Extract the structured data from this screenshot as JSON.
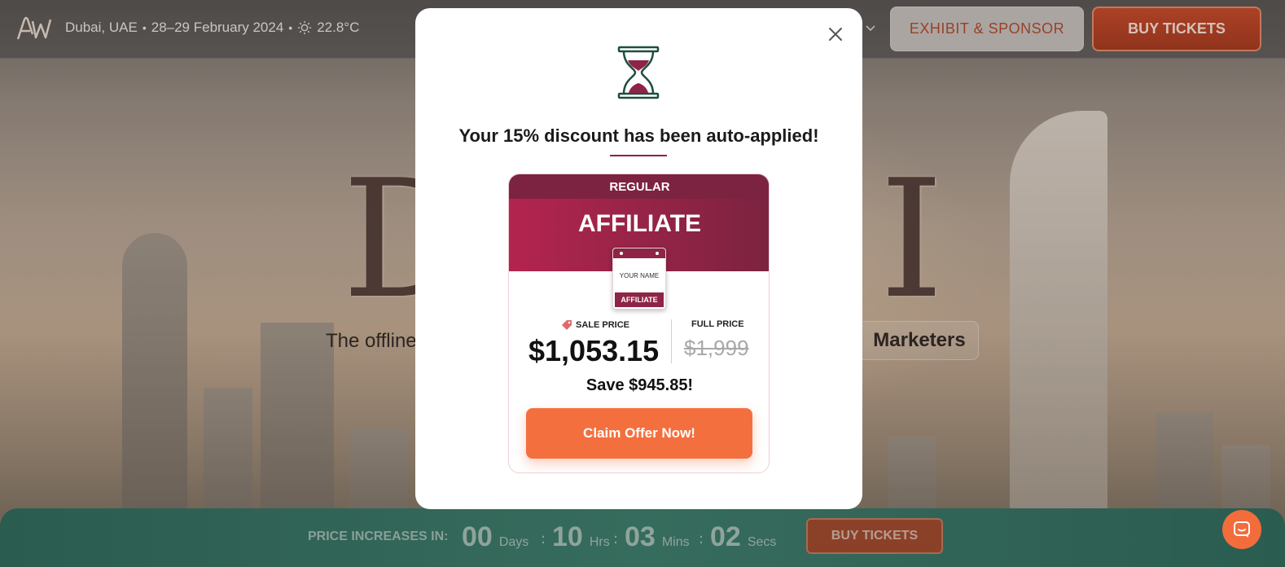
{
  "header": {
    "location": "Dubai, UAE",
    "dates": "28–29 February 2024",
    "separator": "•",
    "temperature": "22.8°C",
    "exhibit_button": "EXHIBIT & SPONSOR",
    "buy_button": "BUY TICKETS"
  },
  "hero": {
    "tagline": "The offline",
    "pill_text": "Marketers"
  },
  "modal": {
    "headline": "Your 15% discount has been auto-applied!",
    "ticket": {
      "tier": "REGULAR",
      "name": "AFFILIATE",
      "badge_name": "YOUR NAME",
      "badge_role": "AFFILIATE",
      "sale_label": "SALE PRICE",
      "sale_price": "$1,053.15",
      "full_label": "FULL PRICE",
      "full_price": "$1,999",
      "savings": "Save $945.85!",
      "cta": "Claim Offer Now!"
    }
  },
  "countdown": {
    "label": "PRICE INCREASES IN:",
    "days": "00",
    "days_unit": "Days",
    "hours": "10",
    "hours_unit": "Hrs",
    "mins": "03",
    "mins_unit": "Mins",
    "secs": "02",
    "secs_unit": "Secs",
    "sep": ":",
    "buy_button": "BUY TICKETS"
  },
  "colors": {
    "accent": "#f46f3e",
    "brand_maroon": "#8e2446",
    "bottom_bar": "#2c6b5c"
  },
  "icons": [
    "logo-icon",
    "sun-icon",
    "chevron-down-icon",
    "close-icon",
    "hourglass-icon",
    "price-tag-icon",
    "chat-icon"
  ]
}
